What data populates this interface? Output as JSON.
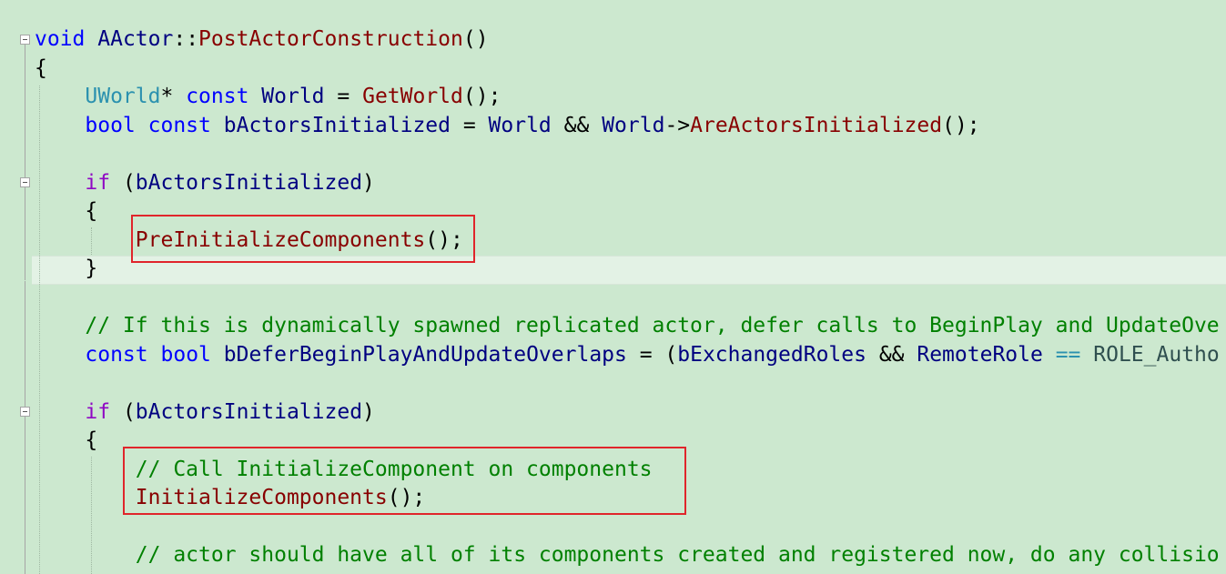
{
  "editor": {
    "lines": [
      {
        "tokens": [
          {
            "t": "void",
            "c": "kw"
          },
          {
            "t": " ",
            "c": "op"
          },
          {
            "t": "AActor",
            "c": "id"
          },
          {
            "t": "::",
            "c": "op"
          },
          {
            "t": "PostActorConstruction",
            "c": "fn"
          },
          {
            "t": "()",
            "c": "op"
          }
        ]
      },
      {
        "tokens": [
          {
            "t": "{",
            "c": "op"
          }
        ]
      },
      {
        "tokens": [
          {
            "t": "    ",
            "c": "op"
          },
          {
            "t": "UWorld",
            "c": "type"
          },
          {
            "t": "* ",
            "c": "op"
          },
          {
            "t": "const",
            "c": "kw"
          },
          {
            "t": " ",
            "c": "op"
          },
          {
            "t": "World",
            "c": "id"
          },
          {
            "t": " = ",
            "c": "op"
          },
          {
            "t": "GetWorld",
            "c": "fn"
          },
          {
            "t": "();",
            "c": "op"
          }
        ]
      },
      {
        "tokens": [
          {
            "t": "    ",
            "c": "op"
          },
          {
            "t": "bool",
            "c": "kw"
          },
          {
            "t": " ",
            "c": "op"
          },
          {
            "t": "const",
            "c": "kw"
          },
          {
            "t": " ",
            "c": "op"
          },
          {
            "t": "bActorsInitialized",
            "c": "id"
          },
          {
            "t": " = ",
            "c": "op"
          },
          {
            "t": "World",
            "c": "id"
          },
          {
            "t": " && ",
            "c": "op"
          },
          {
            "t": "World",
            "c": "id"
          },
          {
            "t": "->",
            "c": "op"
          },
          {
            "t": "AreActorsInitialized",
            "c": "fn"
          },
          {
            "t": "();",
            "c": "op"
          }
        ]
      },
      {
        "tokens": []
      },
      {
        "tokens": [
          {
            "t": "    ",
            "c": "op"
          },
          {
            "t": "if",
            "c": "ctl"
          },
          {
            "t": " (",
            "c": "op"
          },
          {
            "t": "bActorsInitialized",
            "c": "id"
          },
          {
            "t": ")",
            "c": "op"
          }
        ]
      },
      {
        "tokens": [
          {
            "t": "    {",
            "c": "op"
          }
        ]
      },
      {
        "tokens": [
          {
            "t": "        ",
            "c": "op"
          },
          {
            "t": "PreInitializeComponents",
            "c": "fn"
          },
          {
            "t": "();",
            "c": "op"
          }
        ]
      },
      {
        "tokens": [
          {
            "t": "    }",
            "c": "op"
          }
        ]
      },
      {
        "tokens": []
      },
      {
        "tokens": [
          {
            "t": "    ",
            "c": "op"
          },
          {
            "t": "// If this is dynamically spawned replicated actor, defer calls to BeginPlay and UpdateOve",
            "c": "cm"
          }
        ]
      },
      {
        "tokens": [
          {
            "t": "    ",
            "c": "op"
          },
          {
            "t": "const",
            "c": "kw"
          },
          {
            "t": " ",
            "c": "op"
          },
          {
            "t": "bool",
            "c": "kw"
          },
          {
            "t": " ",
            "c": "op"
          },
          {
            "t": "bDeferBeginPlayAndUpdateOverlaps",
            "c": "id"
          },
          {
            "t": " = (",
            "c": "op"
          },
          {
            "t": "bExchangedRoles",
            "c": "id"
          },
          {
            "t": " && ",
            "c": "op"
          },
          {
            "t": "RemoteRole",
            "c": "id"
          },
          {
            "t": " ",
            "c": "op"
          },
          {
            "t": "==",
            "c": "type"
          },
          {
            "t": " ",
            "c": "op"
          },
          {
            "t": "ROLE_Autho",
            "c": "enum"
          }
        ]
      },
      {
        "tokens": []
      },
      {
        "tokens": [
          {
            "t": "    ",
            "c": "op"
          },
          {
            "t": "if",
            "c": "ctl"
          },
          {
            "t": " (",
            "c": "op"
          },
          {
            "t": "bActorsInitialized",
            "c": "id"
          },
          {
            "t": ")",
            "c": "op"
          }
        ]
      },
      {
        "tokens": [
          {
            "t": "    {",
            "c": "op"
          }
        ]
      },
      {
        "tokens": [
          {
            "t": "        ",
            "c": "op"
          },
          {
            "t": "// Call InitializeComponent on components",
            "c": "cm"
          }
        ]
      },
      {
        "tokens": [
          {
            "t": "        ",
            "c": "op"
          },
          {
            "t": "InitializeComponents",
            "c": "fn"
          },
          {
            "t": "();",
            "c": "op"
          }
        ]
      },
      {
        "tokens": []
      },
      {
        "tokens": [
          {
            "t": "        ",
            "c": "op"
          },
          {
            "t": "// actor should have all of its components created and registered now, do any collisio",
            "c": "cm"
          }
        ]
      }
    ]
  }
}
